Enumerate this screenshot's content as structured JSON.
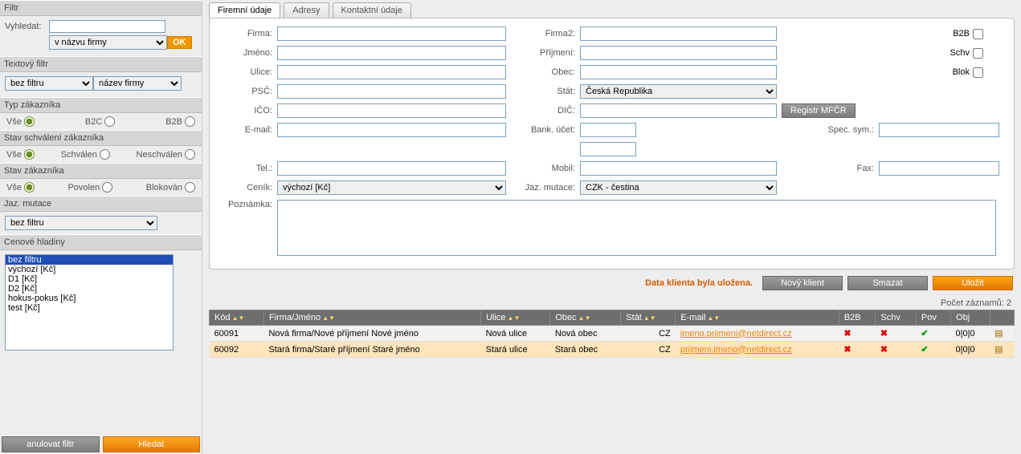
{
  "sidebar": {
    "filtr": "Filtr",
    "vyhledat": "Vyhledat:",
    "vyhledat_sel": "v názvu firmy",
    "ok": "OK",
    "textfiltr": "Textový filtr",
    "tf_sel1": "bez filtru",
    "tf_sel2": "název firmy",
    "typzak": "Typ zákazníka",
    "vse": "Vše",
    "b2c": "B2C",
    "b2b": "B2B",
    "stavschv": "Stav schválení zákazníka",
    "schvalen": "Schválen",
    "neschvalen": "Neschválen",
    "stavzak": "Stav zákazníka",
    "povolen": "Povolen",
    "blokovan": "Blokován",
    "jazmut": "Jaz. mutace",
    "jaz_sel": "bez filtru",
    "cenhl": "Cenové hladiny",
    "list": [
      "bez filtru",
      "výchozí [Kč]",
      "D1 [Kč]",
      "D2 [Kč]",
      "hokus-pokus [Kč]",
      "test [Kč]"
    ],
    "anul": "anulovat filtr",
    "hledat": "Hledat"
  },
  "tabs": [
    "Firemní údaje",
    "Adresy",
    "Kontaktní údaje"
  ],
  "form": {
    "firma": "Firma:",
    "firma2": "Firma2:",
    "jmeno": "Jméno:",
    "prijmeni": "Příjmení:",
    "ulice": "Ulice:",
    "obec": "Obec:",
    "psc": "PSČ:",
    "stat": "Stát:",
    "stat_val": "Česká Republika",
    "ico": "IČO:",
    "dic": "DIČ:",
    "registr": "Registr MFČR",
    "email": "E-mail:",
    "bankucet": "Bank. účet:",
    "specsym": "Spec. sym.:",
    "tel": "Tel.:",
    "mobil": "Mobil:",
    "fax": "Fax:",
    "cenik": "Ceník:",
    "cenik_val": "výchozí [Kč]",
    "jazmutace": "Jaz. mutace:",
    "jazmut_val": "CZK - čestina",
    "poznamka": "Poznámka:",
    "b2b": "B2B",
    "schv": "Schv",
    "blok": "Blok"
  },
  "actions": {
    "saved": "Data klienta byla uložena.",
    "novy": "Nový klient",
    "smazat": "Smazat",
    "ulozit": "Uložit"
  },
  "count": "Počet záznamů: 2",
  "table": {
    "headers": [
      "Kód",
      "Firma/Jméno",
      "Ulice",
      "Obec",
      "Stát",
      "E-mail",
      "B2B",
      "Schv",
      "Pov",
      "Obj"
    ],
    "rows": [
      {
        "kod": "60091",
        "firma": "Nová firma/Nové příjmení Nové jméno",
        "ulice": "Nová ulice",
        "obec": "Nová obec",
        "stat": "CZ",
        "email": "jmeno.prijmeni@netdirect.cz",
        "b2b": "x",
        "schv": "x",
        "pov": "ok",
        "obj": "0|0|0"
      },
      {
        "kod": "60092",
        "firma": "Stará firma/Staré příjmení Staré jméno",
        "ulice": "Stará ulice",
        "obec": "Stará obec",
        "stat": "CZ",
        "email": "prijmeni.jmeno@netdirect.cz",
        "b2b": "x",
        "schv": "x",
        "pov": "ok",
        "obj": "0|0|0"
      }
    ]
  }
}
